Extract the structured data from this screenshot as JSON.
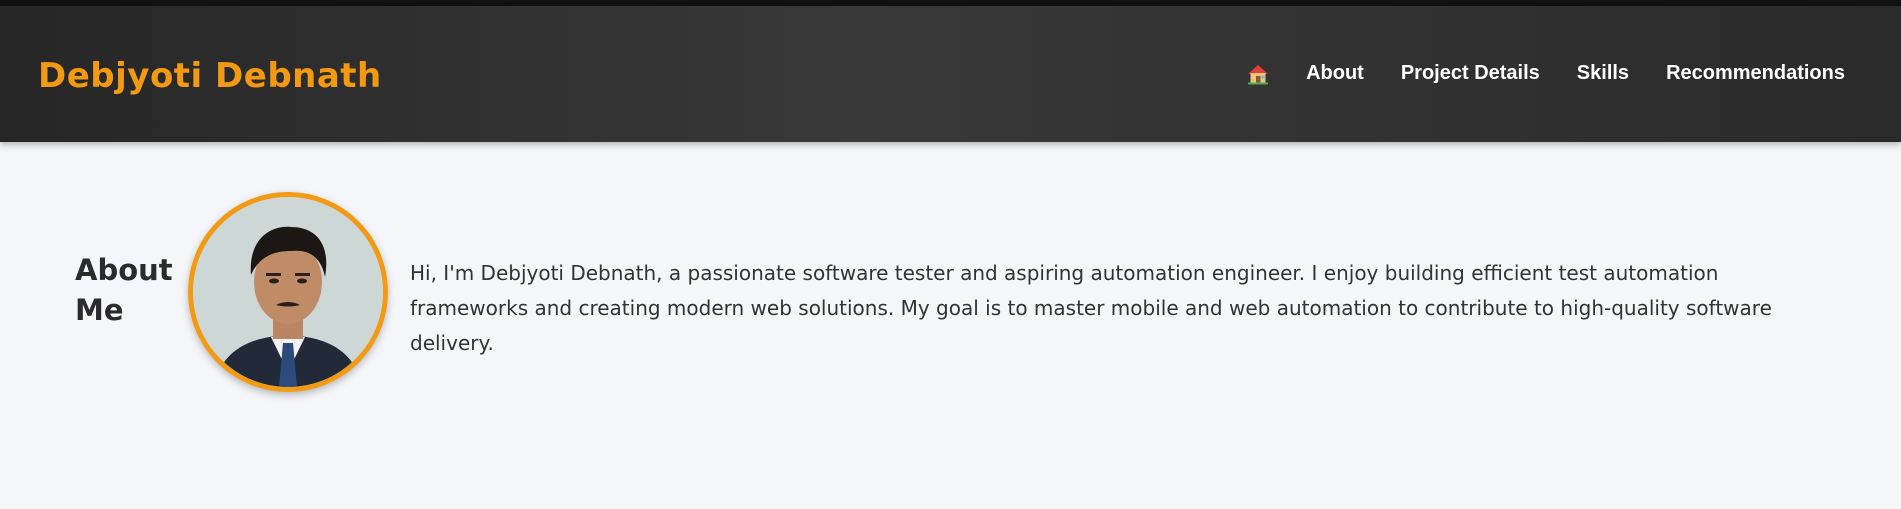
{
  "header": {
    "brand": "Debjyoti Debnath",
    "nav": [
      {
        "label": "About"
      },
      {
        "label": "Project Details"
      },
      {
        "label": "Skills"
      },
      {
        "label": "Recommendations"
      }
    ],
    "home_icon": "house-emoji-icon"
  },
  "about": {
    "title": "About Me",
    "avatar_icon": "profile-photo",
    "text": "Hi, I'm Debjyoti Debnath, a passionate software tester and aspiring automation engineer. I enjoy building efficient test automation frameworks and creating modern web solutions. My goal is to master mobile and web automation to contribute to high-quality software delivery."
  },
  "colors": {
    "accent": "#f39a12",
    "header_bg": "#333333",
    "page_bg": "#f5f6f9"
  }
}
